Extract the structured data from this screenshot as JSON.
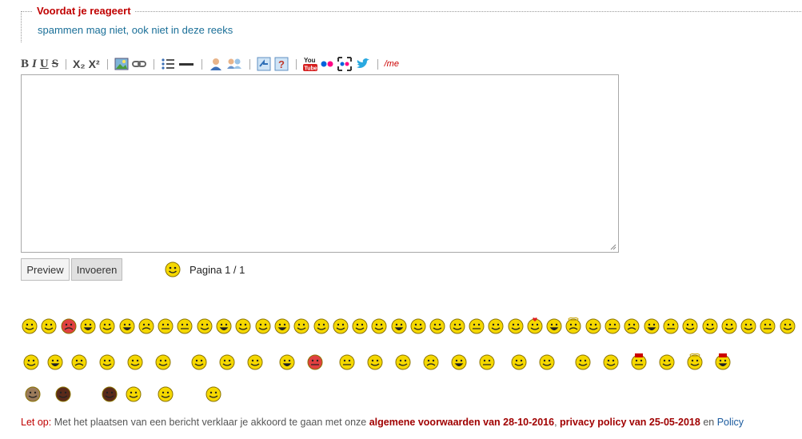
{
  "notice": {
    "legend": "Voordat je reageert",
    "text": "spammen mag niet, ook niet in deze reeks"
  },
  "toolbar": {
    "bold": "B",
    "italic": "I",
    "underline": "U",
    "strike": "S",
    "subscript": "X₂",
    "superscript": "X²",
    "me": "/me",
    "icons": [
      "bold-icon",
      "italic-icon",
      "underline-icon",
      "strikethrough-icon",
      "subscript-icon",
      "superscript-icon",
      "image-icon",
      "link-icon",
      "list-icon",
      "horizontal-rule-icon",
      "user-mention-icon",
      "user-share-icon",
      "quote-icon",
      "help-icon",
      "youtube-icon",
      "flickr-icon",
      "flickr-frame-icon",
      "twitter-icon",
      "me-action-icon"
    ]
  },
  "editor": {
    "value": ""
  },
  "buttons": {
    "preview": "Preview",
    "submit": "Invoeren"
  },
  "pagination": {
    "text": "Pagina 1 / 1"
  },
  "colors": {
    "accent_red": "#c00000",
    "link_blue": "#1a6f98",
    "smiley_yellow": "#f5d800"
  },
  "smileys": {
    "row1_count": 40,
    "row2_count": 25,
    "row3_count": 6,
    "specials": [
      "angry-smiley-icon",
      "heart-smiley-icon",
      "angel-smiley-icon",
      "sleep-smiley-icon",
      "devil-smiley-icon",
      "santa-smiley-icon",
      "moose-smiley-icon",
      "cow-smiley-icon",
      "dutch-flag-smiley-icon",
      "sinterklaas-smiley-icon",
      "zwarte-piet-smiley-icon",
      "beer-smiley-icon",
      "bat-smiley-icon"
    ]
  },
  "footer": {
    "prefix": "Let op:",
    "text1": " Met het plaatsen van een bericht verklaar je akkoord te gaan met onze ",
    "terms": "algemene voorwaarden van 28-10-2016",
    "comma": ", ",
    "privacy": "privacy policy van 25-05-2018",
    "and": " en ",
    "policy": "Policy"
  }
}
